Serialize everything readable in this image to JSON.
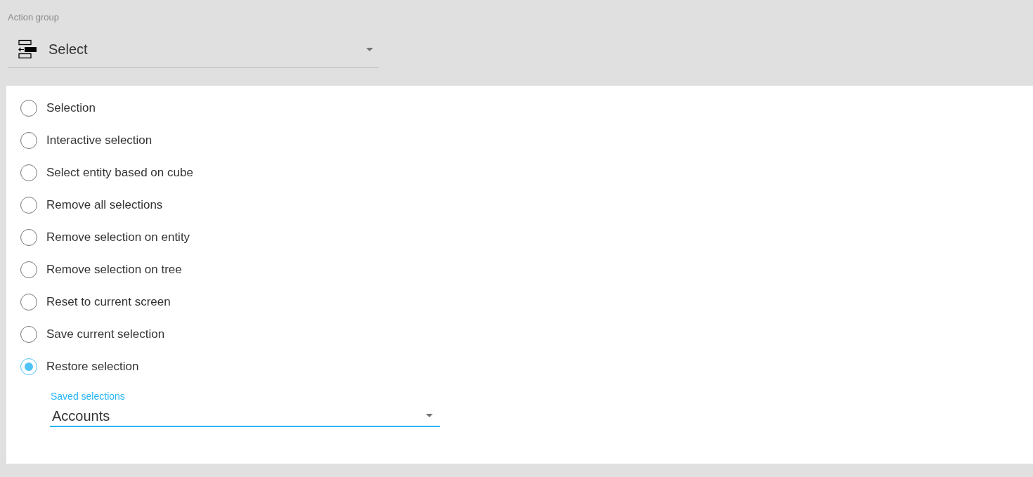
{
  "action_group": {
    "label": "Action group",
    "value": "Select"
  },
  "options": [
    {
      "label": "Selection",
      "selected": false
    },
    {
      "label": "Interactive selection",
      "selected": false
    },
    {
      "label": "Select entity based on cube",
      "selected": false
    },
    {
      "label": "Remove all selections",
      "selected": false
    },
    {
      "label": "Remove selection on entity",
      "selected": false
    },
    {
      "label": "Remove selection on tree",
      "selected": false
    },
    {
      "label": "Reset to current screen",
      "selected": false
    },
    {
      "label": "Save current selection",
      "selected": false
    },
    {
      "label": "Restore selection",
      "selected": true
    }
  ],
  "saved_selections": {
    "label": "Saved selections",
    "value": "Accounts"
  }
}
